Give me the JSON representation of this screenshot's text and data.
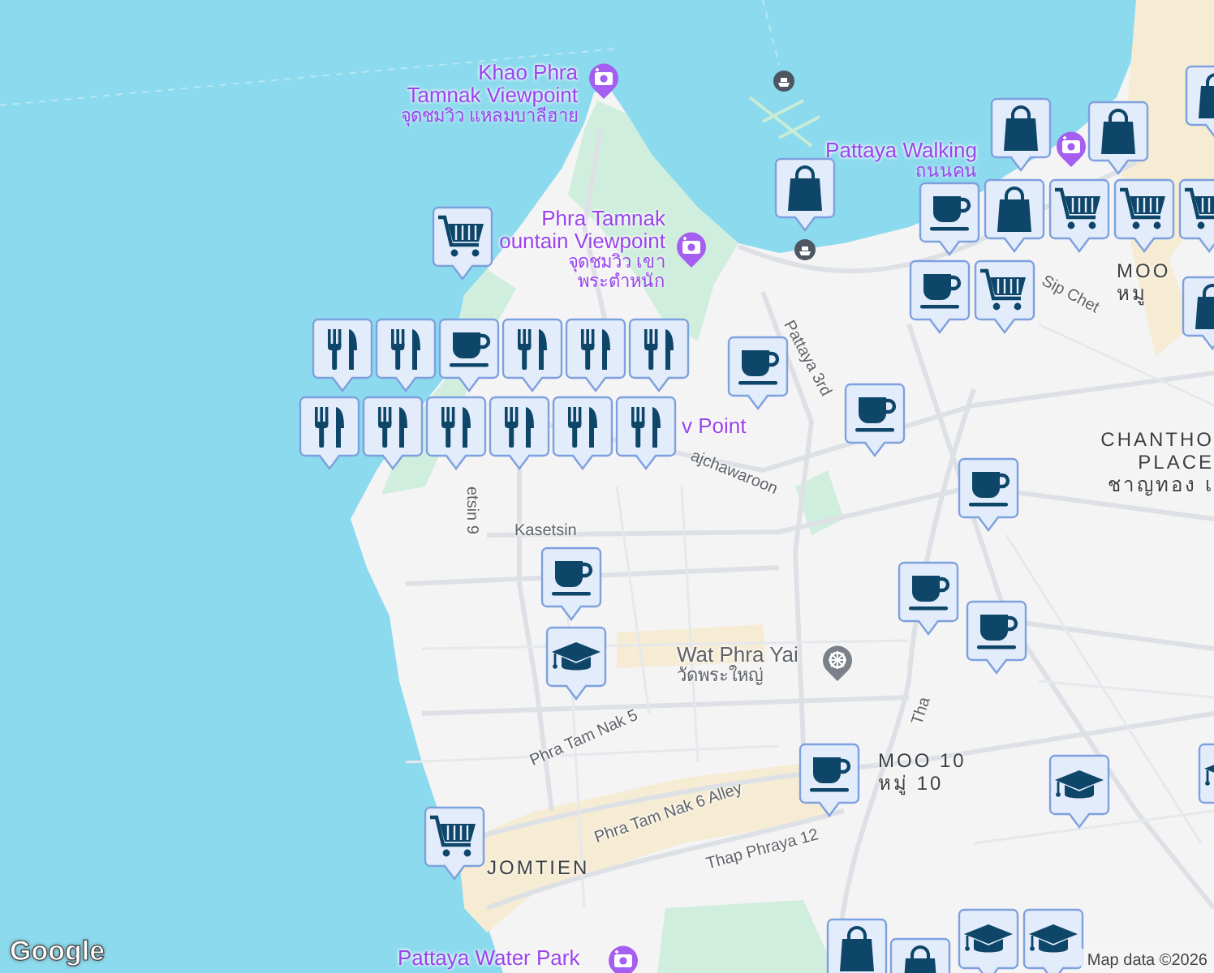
{
  "labels": [
    {
      "kind": "poi",
      "name": "Khao Phra\nTamnak Viewpoint",
      "local_name": "จุดชมวิว แหลมบาลีฮาย"
    },
    {
      "kind": "poi",
      "name": "Phra Tamnak\nountain Viewpoint",
      "local_name": "จุดชมวิว เขา\nพระตำหนัก"
    },
    {
      "kind": "poi",
      "name": "Pattaya Walking",
      "local_name": "ถนนคน"
    },
    {
      "kind": "poi",
      "name": "v Point"
    },
    {
      "kind": "road",
      "name": "Pattaya 3rd"
    },
    {
      "kind": "road",
      "name": "Sip Chet"
    },
    {
      "kind": "area",
      "name": "MOO",
      "local_name": "หมู"
    },
    {
      "kind": "area",
      "name": "CHANTHO\nPLACE",
      "local_name": "ชาญทอง เ"
    },
    {
      "kind": "road",
      "name": "ajchawaroon"
    },
    {
      "kind": "road",
      "name": "etsin 9"
    },
    {
      "kind": "road",
      "name": "Kasetsin"
    },
    {
      "kind": "temple",
      "name": "Wat Phra Yai",
      "local_name": "วัดพระใหญ่"
    },
    {
      "kind": "road",
      "name": "Tha"
    },
    {
      "kind": "road",
      "name": "Phra Tam Nak 5"
    },
    {
      "kind": "area",
      "name": "MOO 10",
      "local_name": "หมู่ 10"
    },
    {
      "kind": "road",
      "name": "Phra Tam Nak 6 Alley"
    },
    {
      "kind": "road",
      "name": "Thap Phraya 12"
    },
    {
      "kind": "area",
      "name": "JOMTIEN"
    },
    {
      "kind": "poi",
      "name": "Pattaya Water Park"
    }
  ],
  "markers": [
    {
      "kind": "shop"
    },
    {
      "kind": "shop"
    },
    {
      "kind": "shop"
    },
    {
      "kind": "shop"
    },
    {
      "kind": "cafe"
    },
    {
      "kind": "shop"
    },
    {
      "kind": "grocery"
    },
    {
      "kind": "grocery"
    },
    {
      "kind": "grocery"
    },
    {
      "kind": "grocery"
    },
    {
      "kind": "shop"
    },
    {
      "kind": "grocery"
    },
    {
      "kind": "cafe"
    },
    {
      "kind": "cafe"
    },
    {
      "kind": "cafe"
    },
    {
      "kind": "cafe"
    },
    {
      "kind": "cafe"
    },
    {
      "kind": "restaurant"
    },
    {
      "kind": "restaurant"
    },
    {
      "kind": "restaurant"
    },
    {
      "kind": "restaurant"
    },
    {
      "kind": "restaurant"
    },
    {
      "kind": "restaurant"
    },
    {
      "kind": "restaurant"
    },
    {
      "kind": "cafe"
    },
    {
      "kind": "school"
    },
    {
      "kind": "cafe"
    },
    {
      "kind": "cafe"
    },
    {
      "kind": "cafe"
    },
    {
      "kind": "school"
    },
    {
      "kind": "school"
    },
    {
      "kind": "grocery"
    },
    {
      "kind": "shop"
    },
    {
      "kind": "school"
    },
    {
      "kind": "school"
    },
    {
      "kind": "restaurant"
    },
    {
      "kind": "restaurant"
    },
    {
      "kind": "restaurant"
    },
    {
      "kind": "restaurant"
    },
    {
      "kind": "shop"
    }
  ],
  "logo": "Google",
  "attribution": "Map data ©2026"
}
